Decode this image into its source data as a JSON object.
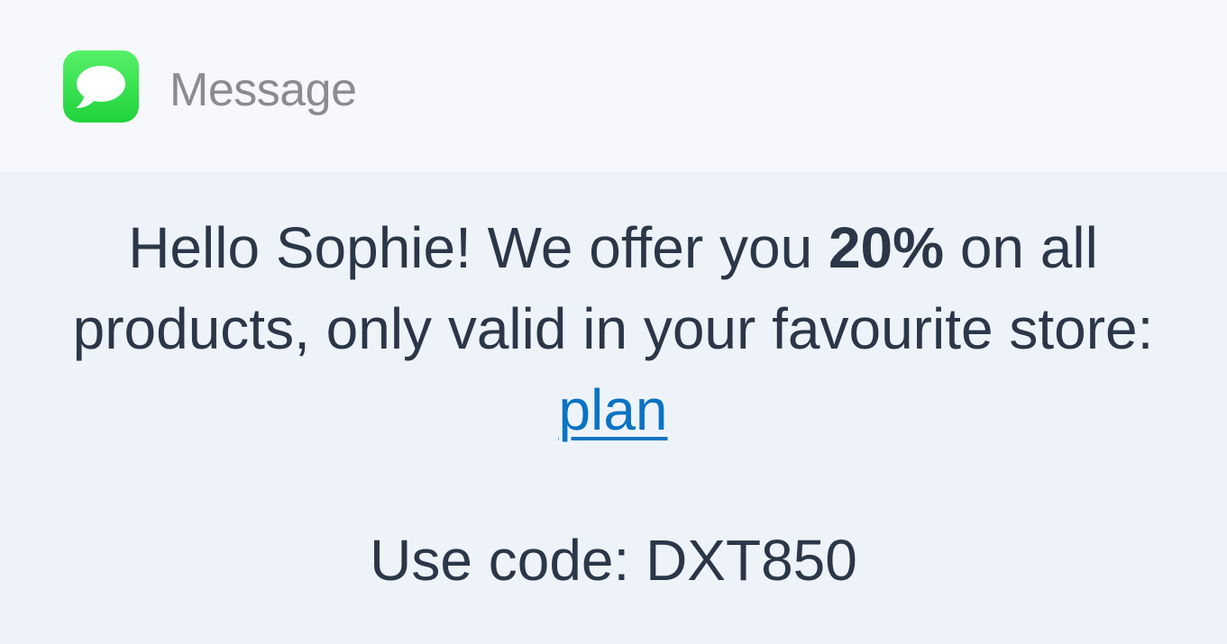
{
  "notification": {
    "app_icon": "messages-bubble-icon",
    "app_name": "Message",
    "accent_color": "#2bd946",
    "message": {
      "part1": "Hello Sophie! We offer you ",
      "bold": "20%",
      "part2": " on all products, only valid in your favourite store: ",
      "link_text": "plan"
    },
    "code_line": "Use code: DXT850"
  }
}
